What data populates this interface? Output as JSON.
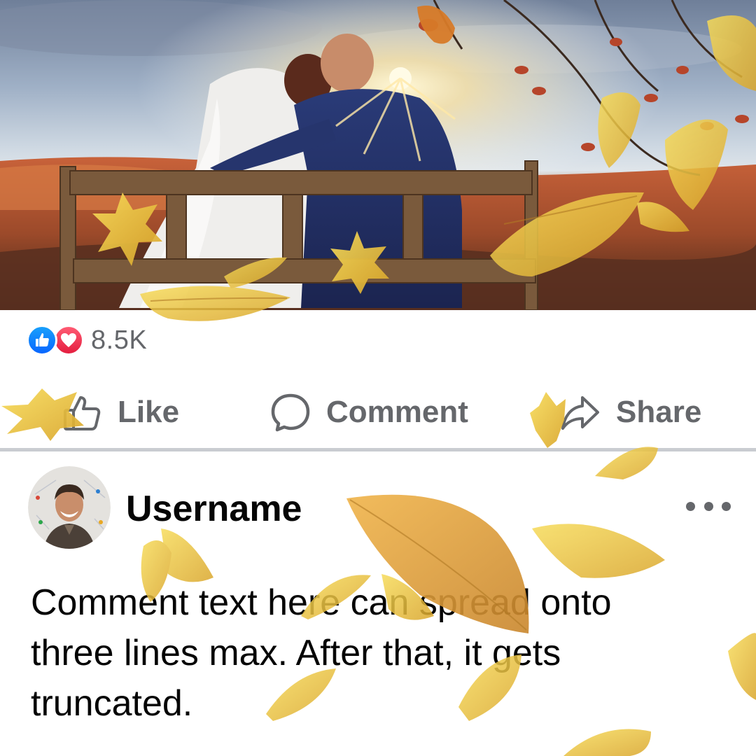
{
  "post": {
    "photo_icon": "wedding-couple-bench-photo",
    "reactions": {
      "icons": [
        "like-icon",
        "love-icon"
      ],
      "count": "8.5K"
    },
    "actions": {
      "like": {
        "label": "Like",
        "icon": "thumbs-up-icon"
      },
      "comment": {
        "label": "Comment",
        "icon": "comment-bubble-icon"
      },
      "share": {
        "label": "Share",
        "icon": "share-arrow-icon"
      }
    }
  },
  "comment": {
    "username": "Username",
    "avatar_icon": "avatar-icon",
    "text": "Comment text here can spread onto three lines max. After that, it gets truncated.",
    "more_icon": "more-options-icon"
  },
  "colors": {
    "like_blue": "#0866ff",
    "love_red": "#e41e3f",
    "secondary_text": "#65676b",
    "divider": "#c9ccd1",
    "leaf_yellow": "#f2c83a"
  }
}
